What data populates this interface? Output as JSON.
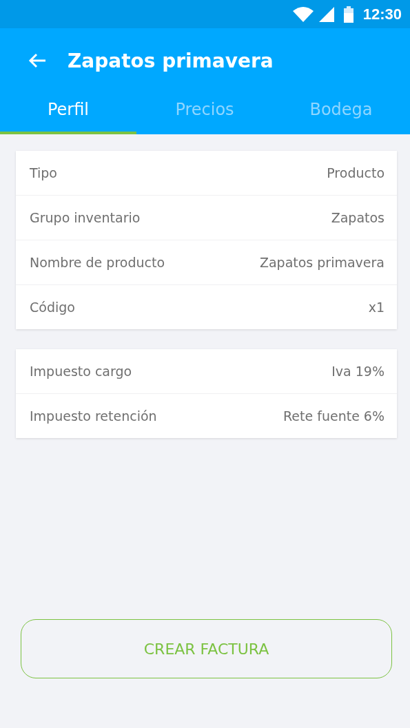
{
  "status_bar": {
    "time": "12:30"
  },
  "app_bar": {
    "title": "Zapatos primavera"
  },
  "tabs": [
    {
      "label": "Perfil",
      "selected": true
    },
    {
      "label": "Precios",
      "selected": false
    },
    {
      "label": "Bodega",
      "selected": false
    }
  ],
  "cards": [
    {
      "rows": [
        {
          "label": "Tipo",
          "value": "Producto"
        },
        {
          "label": "Grupo inventario",
          "value": "Zapatos"
        },
        {
          "label": "Nombre de producto",
          "value": "Zapatos primavera"
        },
        {
          "label": "Código",
          "value": "x1"
        }
      ]
    },
    {
      "rows": [
        {
          "label": "Impuesto cargo",
          "value": "Iva 19%"
        },
        {
          "label": "Impuesto retención",
          "value": "Rete fuente 6%"
        }
      ]
    }
  ],
  "button": {
    "label": "CREAR FACTURA"
  }
}
